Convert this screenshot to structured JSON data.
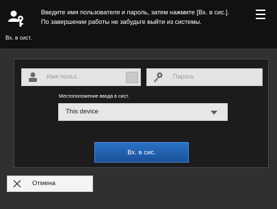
{
  "header": {
    "message_line1": "Введите имя пользователя и пароль, затем нажмите [Вх. в сис.].",
    "message_line2": "По завершении работы не забудьте выйти из системы.",
    "subtitle": "Вх. в сист.",
    "icon": "users-key-icon",
    "menu_icon": "hamburger-menu-icon"
  },
  "login_form": {
    "username_placeholder": "Имя польз.",
    "password_placeholder": "Пароль",
    "location_label": "Местоположение ввода в сист.",
    "location_value": "This device",
    "login_button": "Вх. в сис."
  },
  "footer": {
    "cancel_label": "Отмена"
  },
  "colors": {
    "background": "#303030",
    "header": "#111111",
    "panel": "#1c1c1c",
    "primary_button": "#1f5fb0"
  }
}
